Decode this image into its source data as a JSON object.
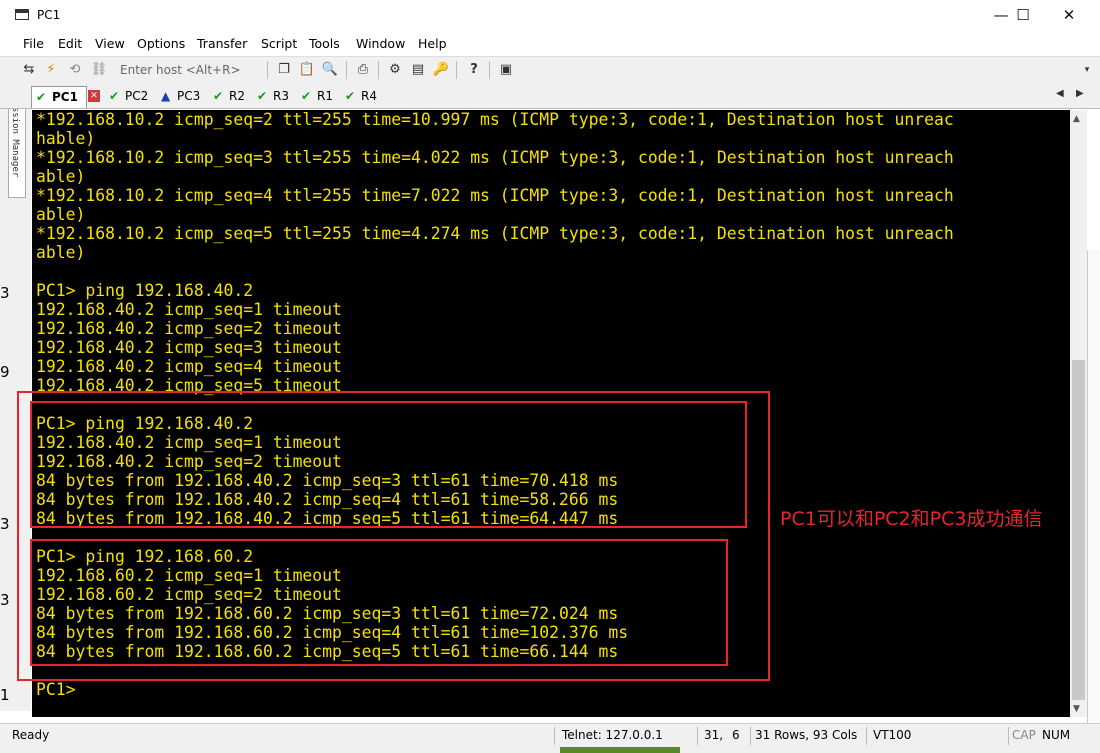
{
  "window": {
    "title": "PC1",
    "minimize": "—",
    "maximize": "☐",
    "close": "✕"
  },
  "menu": [
    "File",
    "Edit",
    "View",
    "Options",
    "Transfer",
    "Script",
    "Tools",
    "Window",
    "Help"
  ],
  "toolbar": {
    "host_placeholder": "Enter host <Alt+R>"
  },
  "tabs": [
    {
      "label": "PC1",
      "status": "ok",
      "active": true
    },
    {
      "label": "PC2",
      "status": "ok"
    },
    {
      "label": "PC3",
      "status": "warning"
    },
    {
      "label": "R2",
      "status": "ok"
    },
    {
      "label": "R3",
      "status": "ok"
    },
    {
      "label": "R1",
      "status": "ok"
    },
    {
      "label": "R4",
      "status": "ok"
    }
  ],
  "session_manager": "Session Manager",
  "left_edge_digits": [
    "3",
    "9",
    "3",
    "3",
    "1"
  ],
  "terminal": {
    "lines": [
      "*192.168.10.2 icmp_seq=2 ttl=255 time=10.997 ms (ICMP type:3, code:1, Destination host unreac",
      "hable)",
      "*192.168.10.2 icmp_seq=3 ttl=255 time=4.022 ms (ICMP type:3, code:1, Destination host unreach",
      "able)",
      "*192.168.10.2 icmp_seq=4 ttl=255 time=7.022 ms (ICMP type:3, code:1, Destination host unreach",
      "able)",
      "*192.168.10.2 icmp_seq=5 ttl=255 time=4.274 ms (ICMP type:3, code:1, Destination host unreach",
      "able)",
      "",
      "PC1> ping 192.168.40.2",
      "192.168.40.2 icmp_seq=1 timeout",
      "192.168.40.2 icmp_seq=2 timeout",
      "192.168.40.2 icmp_seq=3 timeout",
      "192.168.40.2 icmp_seq=4 timeout",
      "192.168.40.2 icmp_seq=5 timeout",
      "",
      "PC1> ping 192.168.40.2",
      "192.168.40.2 icmp_seq=1 timeout",
      "192.168.40.2 icmp_seq=2 timeout",
      "84 bytes from 192.168.40.2 icmp_seq=3 ttl=61 time=70.418 ms",
      "84 bytes from 192.168.40.2 icmp_seq=4 ttl=61 time=58.266 ms",
      "84 bytes from 192.168.40.2 icmp_seq=5 ttl=61 time=64.447 ms",
      "",
      "PC1> ping 192.168.60.2",
      "192.168.60.2 icmp_seq=1 timeout",
      "192.168.60.2 icmp_seq=2 timeout",
      "84 bytes from 192.168.60.2 icmp_seq=3 ttl=61 time=72.024 ms",
      "84 bytes from 192.168.60.2 icmp_seq=4 ttl=61 time=102.376 ms",
      "84 bytes from 192.168.60.2 icmp_seq=5 ttl=61 time=66.144 ms",
      "",
      "PC1>"
    ],
    "text_color": "#f4e100",
    "background": "#000000"
  },
  "annotation": {
    "text": "PC1可以和PC2和PC3成功通信",
    "color": "#e8242d"
  },
  "status": {
    "ready": "Ready",
    "connection": "Telnet: 127.0.0.1",
    "row": "31,",
    "col": "6",
    "size": "31 Rows, 93 Cols",
    "terminal_type": "VT100",
    "cap": "CAP",
    "num": "NUM"
  }
}
